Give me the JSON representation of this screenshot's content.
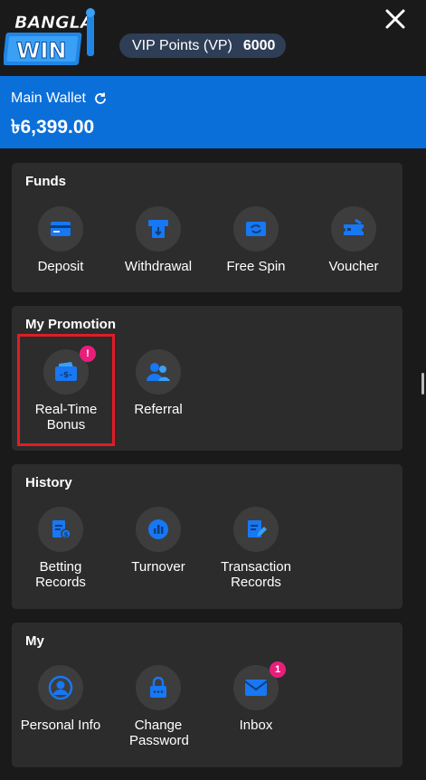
{
  "header": {
    "logo_text": "BANGLA WIN",
    "vip_label": "VIP Points (VP)",
    "vip_value": "6000",
    "close_label": "Close"
  },
  "wallet": {
    "label": "Main Wallet",
    "balance": "৳6,399.00"
  },
  "sections": {
    "funds": {
      "title": "Funds",
      "items": [
        {
          "label": "Deposit",
          "icon": "deposit-card-icon"
        },
        {
          "label": "Withdrawal",
          "icon": "withdrawal-atm-icon"
        },
        {
          "label": "Free Spin",
          "icon": "free-spin-icon"
        },
        {
          "label": "Voucher",
          "icon": "voucher-ticket-icon"
        }
      ]
    },
    "promotion": {
      "title": "My Promotion",
      "items": [
        {
          "label": "Real-Time Bonus",
          "icon": "wallet-money-icon",
          "badge": "!"
        },
        {
          "label": "Referral",
          "icon": "users-icon"
        }
      ]
    },
    "history": {
      "title": "History",
      "items": [
        {
          "label": "Betting Records",
          "icon": "betting-records-icon"
        },
        {
          "label": "Turnover",
          "icon": "turnover-chart-icon"
        },
        {
          "label": "Transaction Records",
          "icon": "transaction-records-icon"
        }
      ]
    },
    "my": {
      "title": "My",
      "items": [
        {
          "label": "Personal Info",
          "icon": "user-profile-icon"
        },
        {
          "label": "Change Password",
          "icon": "lock-icon"
        },
        {
          "label": "Inbox",
          "icon": "mail-icon",
          "badge": "1"
        }
      ]
    }
  },
  "colors": {
    "background": "#1a1a1a",
    "card": "#2c2c2c",
    "wallet": "#0b6fd9",
    "accent_blue": "#1877f2",
    "badge": "#e91e7a",
    "highlight": "#e11c24"
  }
}
